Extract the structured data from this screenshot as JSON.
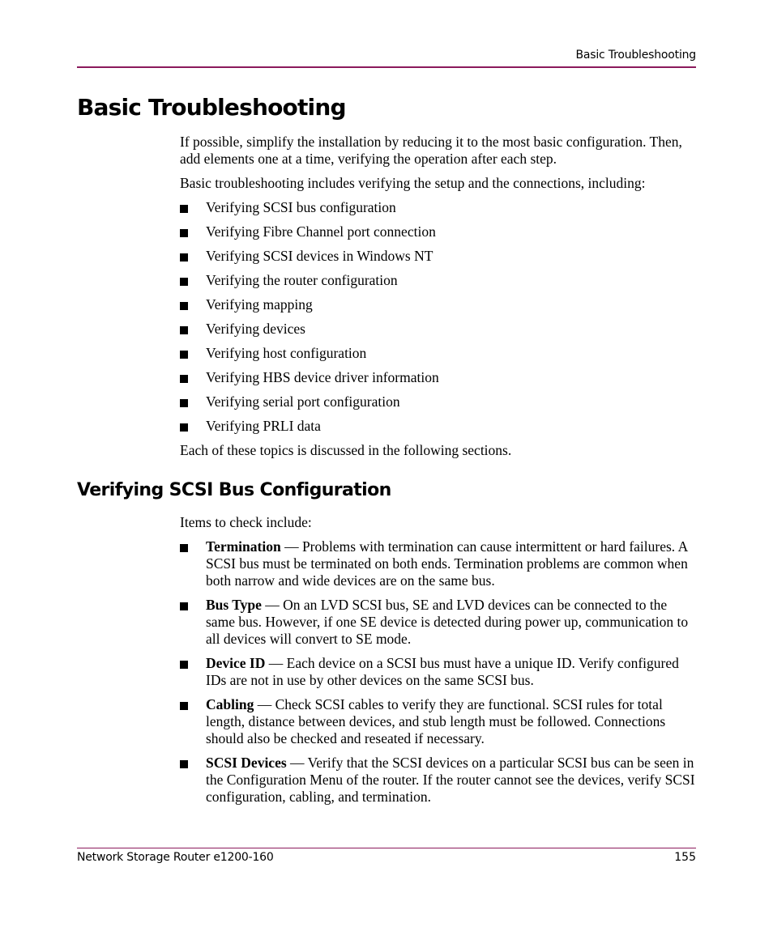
{
  "header": {
    "running_title": "Basic Troubleshooting",
    "rule_color": "#8b1a5c"
  },
  "section1": {
    "title": "Basic Troubleshooting",
    "intro": "If possible, simplify the installation by reducing it to the most basic configuration. Then, add elements one at a time, verifying the operation after each step.",
    "lead": "Basic troubleshooting includes verifying the setup and the connections, including:",
    "items": [
      "Verifying SCSI bus configuration",
      "Verifying Fibre Channel port connection",
      "Verifying SCSI devices in Windows NT",
      "Verifying the router configuration",
      "Verifying mapping",
      "Verifying devices",
      "Verifying host configuration",
      "Verifying HBS device driver information",
      "Verifying serial port configuration",
      "Verifying PRLI data"
    ],
    "closing": "Each of these topics is discussed in the following sections."
  },
  "section2": {
    "title": "Verifying SCSI Bus Configuration",
    "lead": "Items to check include:",
    "items": [
      {
        "term": "Termination",
        "text": " — Problems with termination can cause intermittent or hard failures. A SCSI bus must be terminated on both ends. Termination problems are common when both narrow and wide devices are on the same bus."
      },
      {
        "term": "Bus Type",
        "text": " — On an LVD SCSI bus, SE and LVD devices can be connected to the same bus. However, if one SE device is detected during power up, communication to all devices will convert to SE mode."
      },
      {
        "term": "Device ID",
        "text": " — Each device on a SCSI bus must have a unique ID. Verify configured IDs are not in use by other devices on the same SCSI bus."
      },
      {
        "term": "Cabling",
        "text": " — Check SCSI cables to verify they are functional. SCSI rules for total length, distance between devices, and stub length must be followed. Connections should also be checked and reseated if necessary."
      },
      {
        "term": "SCSI Devices",
        "text": " — Verify that the SCSI devices on a particular SCSI bus can be seen in the Configuration Menu of the router. If the router cannot see the devices, verify SCSI configuration, cabling, and termination."
      }
    ]
  },
  "footer": {
    "product": "Network Storage Router e1200-160",
    "page_number": "155"
  }
}
